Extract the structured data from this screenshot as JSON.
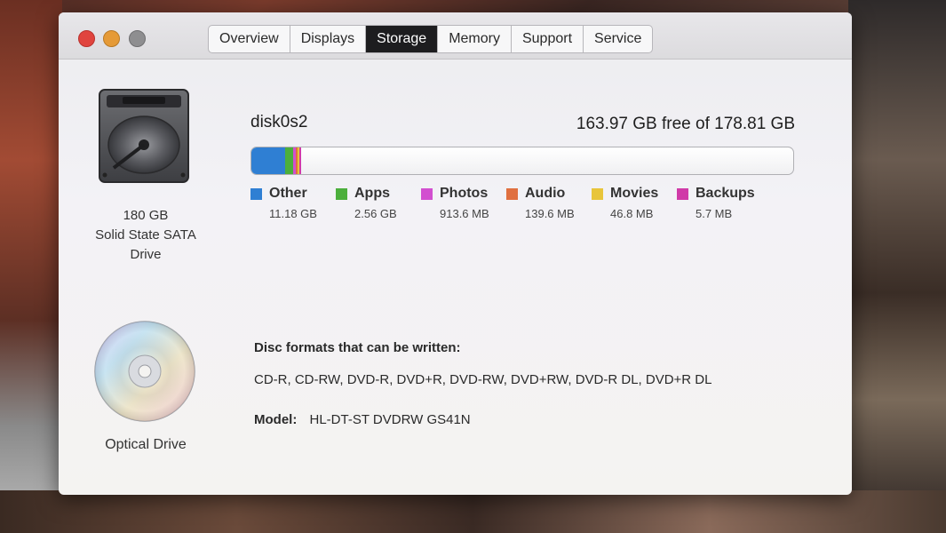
{
  "tabs": [
    {
      "label": "Overview"
    },
    {
      "label": "Displays"
    },
    {
      "label": "Storage",
      "active": true
    },
    {
      "label": "Memory"
    },
    {
      "label": "Support"
    },
    {
      "label": "Service"
    }
  ],
  "drives": {
    "internal": {
      "icon": "hard-drive-icon",
      "caption_lines": [
        "180 GB",
        "Solid State SATA",
        "Drive"
      ]
    },
    "optical": {
      "icon": "cd-icon",
      "caption": "Optical Drive"
    }
  },
  "disk": {
    "name": "disk0s2",
    "free_text": "163.97 GB free of 178.81 GB",
    "capacity_gb": 178.81,
    "free_gb": 163.97
  },
  "usage": [
    {
      "label": "Other",
      "size": "11.18 GB",
      "gb": 11.18,
      "color": "#2f7fd3"
    },
    {
      "label": "Apps",
      "size": "2.56 GB",
      "gb": 2.56,
      "color": "#4caf3c"
    },
    {
      "label": "Photos",
      "size": "913.6 MB",
      "gb": 0.9136,
      "color": "#d24fd0"
    },
    {
      "label": "Audio",
      "size": "139.6 MB",
      "gb": 0.1396,
      "color": "#e07040"
    },
    {
      "label": "Movies",
      "size": "46.8 MB",
      "gb": 0.0468,
      "color": "#e8c53a"
    },
    {
      "label": "Backups",
      "size": "5.7 MB",
      "gb": 0.0057,
      "color": "#d03aa8"
    }
  ],
  "optical_info": {
    "formats_title": "Disc formats that can be written:",
    "formats": "CD-R, CD-RW, DVD-R, DVD+R, DVD-RW, DVD+RW, DVD-R DL, DVD+R DL",
    "model_label": "Model:",
    "model_value": "HL-DT-ST DVDRW GS41N"
  }
}
